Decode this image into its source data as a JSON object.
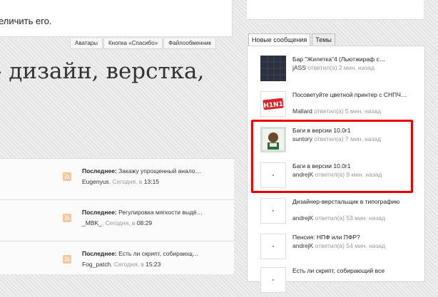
{
  "top_card": {
    "text": "еличить его."
  },
  "top_tabs": [
    "Аватары",
    "Кнопка «Спасибо»",
    "Файлообменник"
  ],
  "big_title": "- дизайн, верстка,",
  "forum_rows": [
    {
      "label": "Последнее:",
      "title": "Закажу упрощенный анало…",
      "user": "Eugenyus",
      "date_prefix": "Сегодня, в",
      "time": "13:15"
    },
    {
      "label": "Последнее:",
      "title": "Регулировка мягкости выдё…",
      "user": "_MBK_",
      "date_prefix": "Сегодня, в",
      "time": "08:29"
    },
    {
      "label": "Последнее:",
      "title": "Есть ли скрипт, собирающ…",
      "user": "Fog_patch",
      "date_prefix": "Сегодня, в",
      "time": "15:23"
    }
  ],
  "sidebar": {
    "tabs": [
      {
        "label": "Новые сообщения"
      },
      {
        "label": "Темы"
      }
    ],
    "messages": [
      {
        "title": "Бар \"Жилетка\"4 (Льютжираф с…",
        "user": "jASS",
        "action": "ответил(а) 2 мин. назад",
        "thumb": "dark"
      },
      {
        "title": "Посоветуйте цветной принтер с СНПЧ…",
        "user": "Mallard",
        "action": "ответил(а) 5 мин. назад",
        "thumb": "h1n1",
        "thumb_text": "H1N1"
      },
      {
        "title": "Баги в версии 10.0r1",
        "user": "suntory",
        "action": "ответил(а) 7 мин. назад",
        "thumb": "photo"
      },
      {
        "title": "Баги в версии 10.0r1",
        "user": "andrejK",
        "action": "ответил(а) 9 мин. назад",
        "thumb": "blank"
      },
      {
        "title": "Дизайнер-верстальщик в типографию",
        "user": "andrejK",
        "action": "ответил(а) 53 мин. назад",
        "thumb": "blank"
      },
      {
        "title": "Пенсия: НПФ или ПФР?",
        "user": "andrejK",
        "action": "ответил(а) 54 мин. назад",
        "thumb": "blank"
      },
      {
        "title": "Есть ли скрипт, собирающий все",
        "user": "",
        "action": "",
        "thumb": "blank"
      }
    ]
  },
  "colors": {
    "highlight": "#e60000",
    "rss": "#f6c79a"
  }
}
